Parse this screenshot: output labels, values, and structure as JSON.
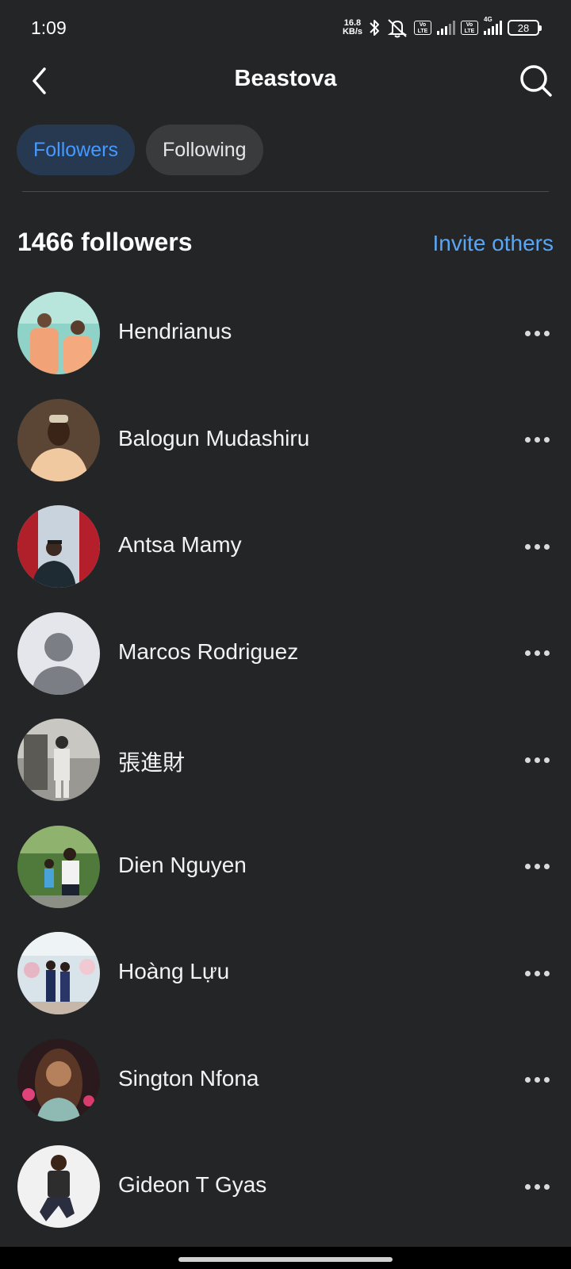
{
  "status_bar": {
    "time": "1:09",
    "net_speed_value": "16.8",
    "net_speed_unit": "KB/s",
    "volte_1": "Vo LTE",
    "volte_2": "Vo LTE",
    "network_type": "4G",
    "battery": "28",
    "icons": [
      "bluetooth-icon",
      "mute-icon",
      "signal-icon",
      "battery-icon"
    ]
  },
  "header": {
    "title": "Beastova",
    "back_icon": "chevron-left-icon",
    "search_icon": "search-icon"
  },
  "tabs": [
    {
      "label": "Followers",
      "active": true
    },
    {
      "label": "Following",
      "active": false
    }
  ],
  "section": {
    "count_label": "1466 followers",
    "invite_label": "Invite others"
  },
  "followers": [
    {
      "name": "Hendrianus"
    },
    {
      "name": "Balogun Mudashiru"
    },
    {
      "name": "Antsa Mamy"
    },
    {
      "name": "Marcos Rodriguez"
    },
    {
      "name": "張進財"
    },
    {
      "name": "Dien Nguyen"
    },
    {
      "name": "Hoàng Lựu"
    },
    {
      "name": "Sington Nfona"
    },
    {
      "name": "Gideon T Gyas"
    }
  ],
  "colors": {
    "background": "#242526",
    "active_tab_bg": "#263951",
    "active_tab_text": "#4599ff",
    "inactive_tab_bg": "#3a3b3c",
    "link": "#5aa6f4"
  }
}
